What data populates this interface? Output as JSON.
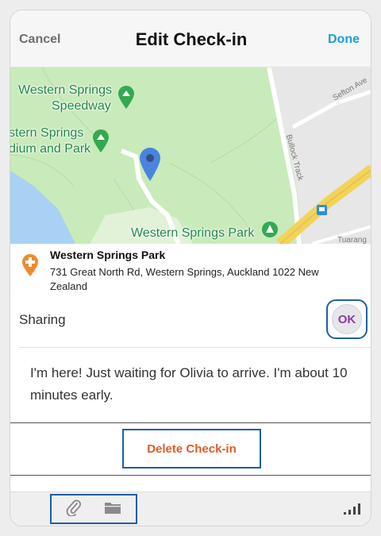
{
  "navbar": {
    "cancel_label": "Cancel",
    "title": "Edit Check-in",
    "done_label": "Done"
  },
  "map": {
    "labels": {
      "speedway_line1": "Western Springs",
      "speedway_line2": "Speedway",
      "stadium_line1": "stern Springs",
      "stadium_line2": "dium and Park",
      "park": "Western Springs Park"
    },
    "streets": {
      "sefton": "Sefton Ave",
      "bullock": "Bullock Track",
      "tuarang": "Tuarang"
    },
    "colors": {
      "park": "#c9eabb",
      "water": "#a9d1f3",
      "road": "#ffffff",
      "highway": "#f2d35a",
      "pin": "#4a84e0",
      "label": "#1e8a48"
    }
  },
  "location": {
    "icon": "location-plus-icon",
    "name": "Western Springs Park",
    "address": "731 Great North Rd, Western Springs, Auckland 1022 New Zealand"
  },
  "sharing": {
    "label": "Sharing",
    "button_label": "OK"
  },
  "message": {
    "text": "I'm here! Just waiting for Olivia to arrive. I'm about 10 minutes early."
  },
  "actions": {
    "delete_label": "Delete Check-in"
  },
  "toolbar": {
    "icons": [
      "paperclip-icon",
      "folder-icon",
      "signal-icon"
    ]
  },
  "colors": {
    "accent": "#1aa0d8",
    "delete": "#e05a28",
    "ok_text": "#8e3a9e",
    "highlight_frame": "#1f5fa6"
  }
}
